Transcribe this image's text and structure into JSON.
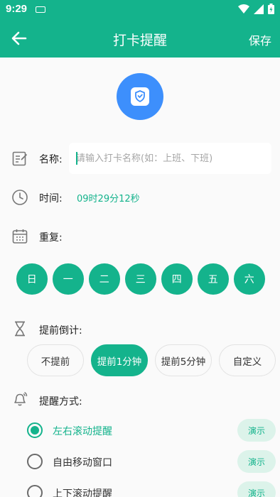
{
  "status_bar": {
    "time": "9:29"
  },
  "app_bar": {
    "title": "打卡提醒",
    "save_label": "保存"
  },
  "name": {
    "label": "名称:",
    "placeholder": "请输入打卡名称(如：上班、下班)"
  },
  "time": {
    "label": "时间:",
    "value": "09时29分12秒"
  },
  "repeat": {
    "label": "重复:",
    "days": [
      "日",
      "一",
      "二",
      "三",
      "四",
      "五",
      "六"
    ]
  },
  "countdown": {
    "label": "提前倒计:",
    "options": [
      "不提前",
      "提前1分钟",
      "提前5分钟",
      "自定义"
    ],
    "selected_index": 1
  },
  "reminder": {
    "label": "提醒方式:",
    "demo_label": "演示",
    "options": [
      "左右滚动提醒",
      "自由移动窗口",
      "上下滚动提醒"
    ],
    "selected_index": 0
  },
  "colors": {
    "accent": "#14b38c",
    "logo_bg": "#3d8ffc"
  }
}
